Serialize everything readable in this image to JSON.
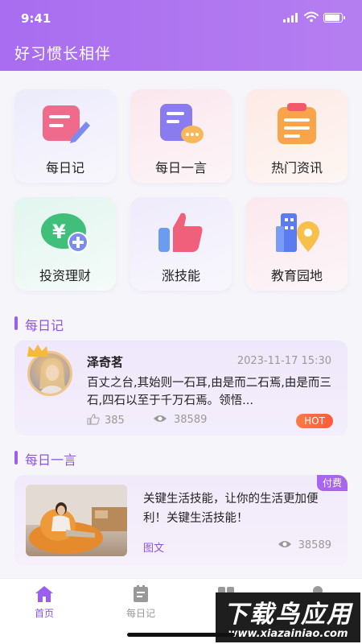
{
  "status_bar": {
    "time": "9:41"
  },
  "header": {
    "title": "好习惯长相伴"
  },
  "grid": {
    "items": [
      {
        "label": "每日记",
        "icon": "notebook-pencil-icon"
      },
      {
        "label": "每日一言",
        "icon": "chat-document-icon"
      },
      {
        "label": "热门资讯",
        "icon": "clipboard-news-icon"
      },
      {
        "label": "投资理财",
        "icon": "yen-coin-add-icon"
      },
      {
        "label": "涨技能",
        "icon": "thumbs-up-icon"
      },
      {
        "label": "教育园地",
        "icon": "building-location-icon"
      }
    ]
  },
  "section_diary": {
    "title": "每日记",
    "card": {
      "author": "泽奇茗",
      "date": "2023-11-17 15:30",
      "excerpt": "百丈之台,其始则一石耳,由是而二石焉,由是而三石,四石以至于千万石焉。领悟...",
      "likes": "385",
      "views": "38589",
      "badge": "HOT"
    }
  },
  "section_quote": {
    "title": "每日一言",
    "card": {
      "paid_badge": "付费",
      "text": "关键生活技能，让你的生活更加便利！关键生活技能！",
      "tag": "图文",
      "views": "38589"
    }
  },
  "tabbar": {
    "tabs": [
      {
        "label": "首页",
        "active": true
      },
      {
        "label": "每日记",
        "active": false
      }
    ]
  },
  "watermark": {
    "title": "下载鸟应用",
    "url": "www.xiazainiao.com"
  },
  "colors": {
    "accent": "#9a5ff0",
    "header": "#a86df0",
    "hot": "#ff5a3a"
  }
}
